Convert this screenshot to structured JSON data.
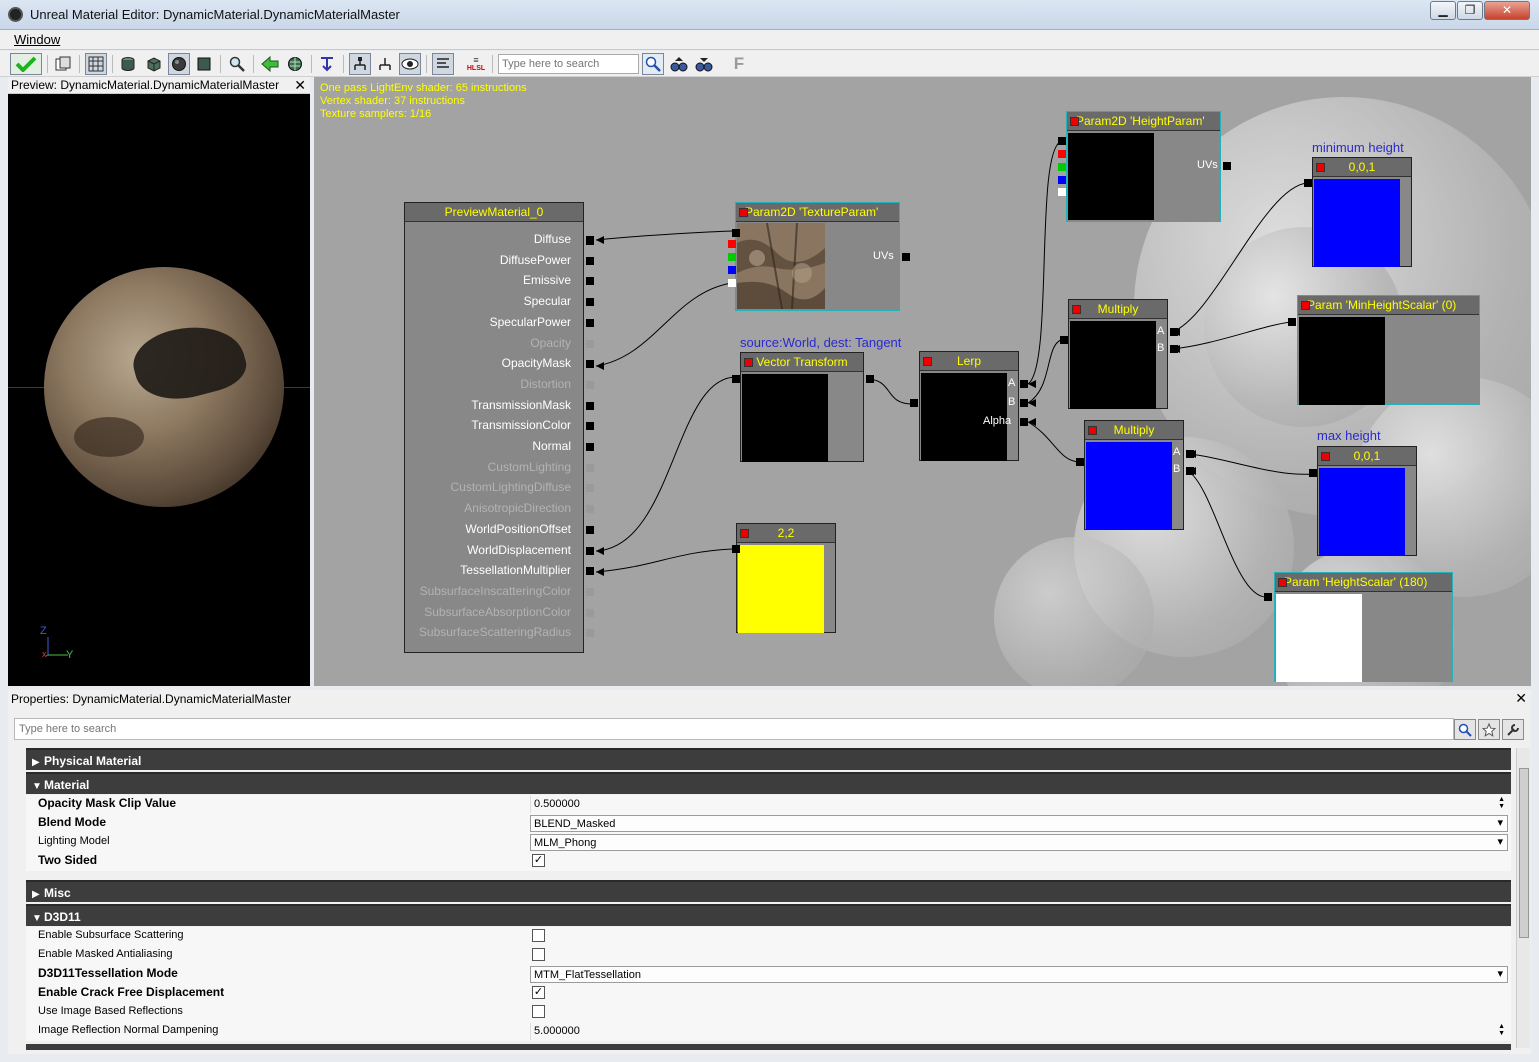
{
  "window": {
    "title": "Unreal Material Editor: DynamicMaterial.DynamicMaterialMaster",
    "minimize": "▁",
    "restore": "❐",
    "close": "✕"
  },
  "menu": {
    "window": "Window"
  },
  "toolbar": {
    "search_placeholder": "Type here to search",
    "hlsl": "HLSL",
    "f_label": "F"
  },
  "preview": {
    "title": "Preview: DynamicMaterial.DynamicMaterialMaster",
    "close": "✕",
    "axis_z": "Z",
    "axis_y": "Y",
    "axis_x": "x"
  },
  "stats": {
    "line1": "One pass LightEnv shader: 65 instructions",
    "line2": "Vertex shader: 37 instructions",
    "line3": "Texture samplers: 1/16"
  },
  "nodes": {
    "preview_material": {
      "title": "PreviewMaterial_0",
      "inputs": [
        {
          "label": "Diffuse",
          "dim": false
        },
        {
          "label": "DiffusePower",
          "dim": false
        },
        {
          "label": "Emissive",
          "dim": false
        },
        {
          "label": "Specular",
          "dim": false
        },
        {
          "label": "SpecularPower",
          "dim": false
        },
        {
          "label": "Opacity",
          "dim": true
        },
        {
          "label": "OpacityMask",
          "dim": false
        },
        {
          "label": "Distortion",
          "dim": true
        },
        {
          "label": "TransmissionMask",
          "dim": false
        },
        {
          "label": "TransmissionColor",
          "dim": false
        },
        {
          "label": "Normal",
          "dim": false
        },
        {
          "label": "CustomLighting",
          "dim": true
        },
        {
          "label": "CustomLightingDiffuse",
          "dim": true
        },
        {
          "label": "AnisotropicDirection",
          "dim": true
        },
        {
          "label": "WorldPositionOffset",
          "dim": false
        },
        {
          "label": "WorldDisplacement",
          "dim": false
        },
        {
          "label": "TessellationMultiplier",
          "dim": false
        },
        {
          "label": "SubsurfaceInscatteringColor",
          "dim": true
        },
        {
          "label": "SubsurfaceAbsorptionColor",
          "dim": true
        },
        {
          "label": "SubsurfaceScatteringRadius",
          "dim": true
        }
      ]
    },
    "texture_param": {
      "title": "Param2D 'TextureParam'",
      "uvs": "UVs"
    },
    "height_param": {
      "title": "Param2D 'HeightParam'",
      "uvs": "UVs"
    },
    "vector_transform": {
      "title": "Vector Transform",
      "caption": "source:World, dest: Tangent"
    },
    "lerp": {
      "title": "Lerp",
      "a": "A",
      "b": "B",
      "alpha": "Alpha"
    },
    "multiply1": {
      "title": "Multiply",
      "a": "A",
      "b": "B"
    },
    "multiply2": {
      "title": "Multiply",
      "a": "A",
      "b": "B"
    },
    "min_height": {
      "title": "0,0,1",
      "caption": "minimum height"
    },
    "max_height": {
      "title": "0,0,1",
      "caption": "max height"
    },
    "min_height_scalar": {
      "title": "Param 'MinHeightScalar' (0)"
    },
    "height_scalar": {
      "title": "Param 'HeightScalar' (180)"
    },
    "const22": {
      "title": "2,2"
    }
  },
  "colors": {
    "yellow": "#ffff00",
    "blue": "#0000ff",
    "canvas": "#a3a3a3",
    "selected": "#26b0b8"
  },
  "properties": {
    "title": "Properties: DynamicMaterial.DynamicMaterialMaster",
    "close": "✕",
    "search_placeholder": "Type here to search",
    "sections": {
      "physical_material": "Physical Material",
      "material": "Material",
      "misc": "Misc",
      "d3d11": "D3D11"
    },
    "material_rows": {
      "opacity_mask_clip": {
        "label": "Opacity Mask Clip Value",
        "value": "0.500000"
      },
      "blend_mode": {
        "label": "Blend Mode",
        "value": "BLEND_Masked"
      },
      "lighting_model": {
        "label": "Lighting Model",
        "value": "MLM_Phong"
      },
      "two_sided": {
        "label": "Two Sided",
        "checked": true
      }
    },
    "d3d11_rows": {
      "subsurface": {
        "label": "Enable Subsurface Scattering",
        "checked": false
      },
      "masked_aa": {
        "label": "Enable Masked Antialiasing",
        "checked": false
      },
      "tess_mode": {
        "label": "D3D11Tessellation Mode",
        "value": "MTM_FlatTessellation"
      },
      "crack_free": {
        "label": "Enable Crack Free Displacement",
        "checked": true
      },
      "ibr": {
        "label": "Use Image Based Reflections",
        "checked": false
      },
      "ibr_normal": {
        "label": "Image Reflection Normal Dampening",
        "value": "5.000000"
      }
    }
  }
}
